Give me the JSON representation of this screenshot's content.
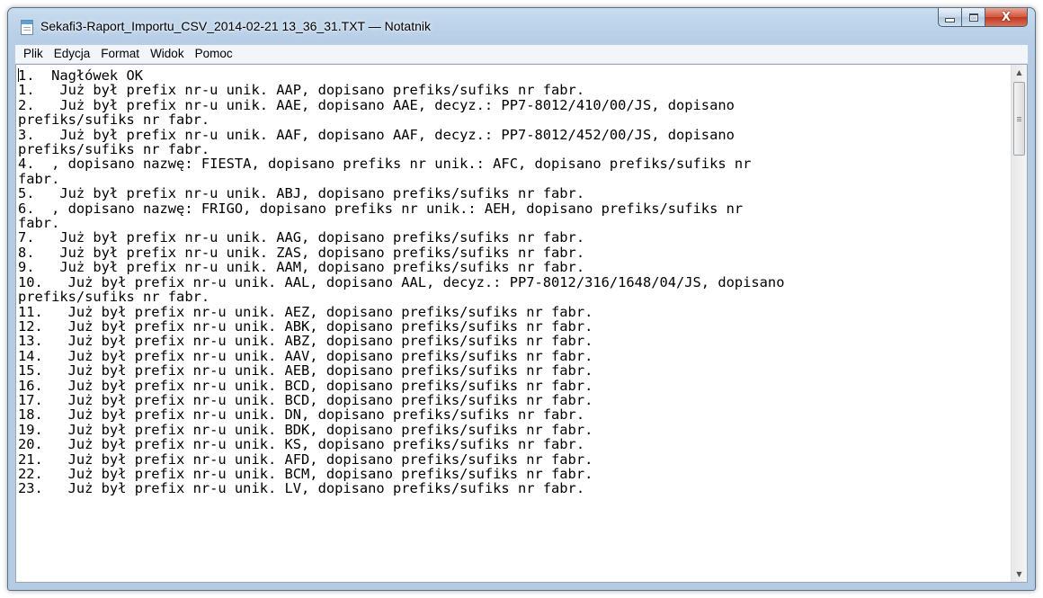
{
  "window": {
    "title": "Sekafi3-Raport_Importu_CSV_2014-02-21 13_36_31.TXT — Notatnik"
  },
  "caption_buttons": {
    "minimize_icon": "minimize-icon",
    "maximize_icon": "maximize-icon",
    "close_icon": "close-icon",
    "close_glyph": "X"
  },
  "menu": {
    "items": [
      "Plik",
      "Edycja",
      "Format",
      "Widok",
      "Pomoc"
    ]
  },
  "document": {
    "lines": [
      "1.  Nagłówek OK",
      "1.   Już był prefix nr-u unik. AAP, dopisano prefiks/sufiks nr fabr.",
      "2.   Już był prefix nr-u unik. AAE, dopisano AAE, decyz.: PP7-8012/410/00/JS, dopisano",
      "prefiks/sufiks nr fabr.",
      "3.   Już był prefix nr-u unik. AAF, dopisano AAF, decyz.: PP7-8012/452/00/JS, dopisano",
      "prefiks/sufiks nr fabr.",
      "4.  , dopisano nazwę: FIESTA, dopisano prefiks nr unik.: AFC, dopisano prefiks/sufiks nr",
      "fabr.",
      "5.   Już był prefix nr-u unik. ABJ, dopisano prefiks/sufiks nr fabr.",
      "6.  , dopisano nazwę: FRIGO, dopisano prefiks nr unik.: AEH, dopisano prefiks/sufiks nr",
      "fabr.",
      "7.   Już był prefix nr-u unik. AAG, dopisano prefiks/sufiks nr fabr.",
      "8.   Już był prefix nr-u unik. ZAS, dopisano prefiks/sufiks nr fabr.",
      "9.   Już był prefix nr-u unik. AAM, dopisano prefiks/sufiks nr fabr.",
      "10.   Już był prefix nr-u unik. AAL, dopisano AAL, decyz.: PP7-8012/316/1648/04/JS, dopisano",
      "prefiks/sufiks nr fabr.",
      "11.   Już był prefix nr-u unik. AEZ, dopisano prefiks/sufiks nr fabr.",
      "12.   Już był prefix nr-u unik. ABK, dopisano prefiks/sufiks nr fabr.",
      "13.   Już był prefix nr-u unik. ABZ, dopisano prefiks/sufiks nr fabr.",
      "14.   Już był prefix nr-u unik. AAV, dopisano prefiks/sufiks nr fabr.",
      "15.   Już był prefix nr-u unik. AEB, dopisano prefiks/sufiks nr fabr.",
      "16.   Już był prefix nr-u unik. BCD, dopisano prefiks/sufiks nr fabr.",
      "17.   Już był prefix nr-u unik. BCD, dopisano prefiks/sufiks nr fabr.",
      "18.   Już był prefix nr-u unik. DN, dopisano prefiks/sufiks nr fabr.",
      "19.   Już był prefix nr-u unik. BDK, dopisano prefiks/sufiks nr fabr.",
      "20.   Już był prefix nr-u unik. KS, dopisano prefiks/sufiks nr fabr.",
      "21.   Już był prefix nr-u unik. AFD, dopisano prefiks/sufiks nr fabr.",
      "22.   Już był prefix nr-u unik. BCM, dopisano prefiks/sufiks nr fabr.",
      "23.   Już był prefix nr-u unik. LV, dopisano prefiks/sufiks nr fabr."
    ]
  },
  "scrollbar": {
    "up_icon": "scroll-up-arrow-icon",
    "down_icon": "scroll-down-arrow-icon",
    "up_glyph": "▲",
    "down_glyph": "▼"
  },
  "colors": {
    "title_bar": "#b9d0e8",
    "close_button": "#c0391f",
    "editor_background": "#ffffff",
    "text": "#000000"
  }
}
